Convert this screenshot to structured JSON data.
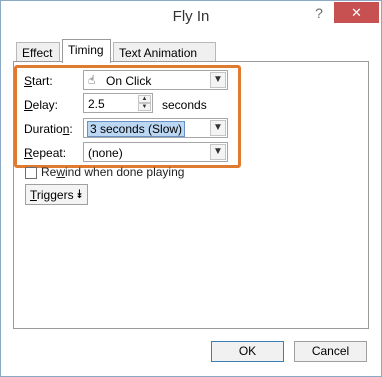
{
  "window": {
    "title": "Fly In",
    "help_label": "?",
    "close_label": "✕"
  },
  "tabs": [
    {
      "label": "Effect",
      "active": false
    },
    {
      "label": "Timing",
      "active": true
    },
    {
      "label": "Text Animation",
      "active": false
    }
  ],
  "timing": {
    "start": {
      "label_key": "S",
      "label_rest": "tart:",
      "value": "On Click",
      "icon": "mouse-click-icon"
    },
    "delay": {
      "label_key": "D",
      "label_rest": "elay:",
      "value": "2.5",
      "unit": "seconds"
    },
    "duration": {
      "label_key": "",
      "label_rest": "Duration:",
      "label_underline": "n",
      "value": "3 seconds (Slow)"
    },
    "repeat": {
      "label_key": "R",
      "label_rest": "epeat:",
      "value": "(none)"
    },
    "rewind": {
      "label_pre": "Re",
      "label_key": "w",
      "label_rest": "ind when done playing",
      "checked": false
    },
    "triggers": {
      "label_key": "T",
      "label_rest": "riggers",
      "icon": "double-chevron-down-icon"
    }
  },
  "footer": {
    "ok_label": "OK",
    "cancel_label": "Cancel"
  },
  "colors": {
    "highlight": "#e07a2e",
    "close_button": "#c75050",
    "selection": "#bcd7f2"
  }
}
